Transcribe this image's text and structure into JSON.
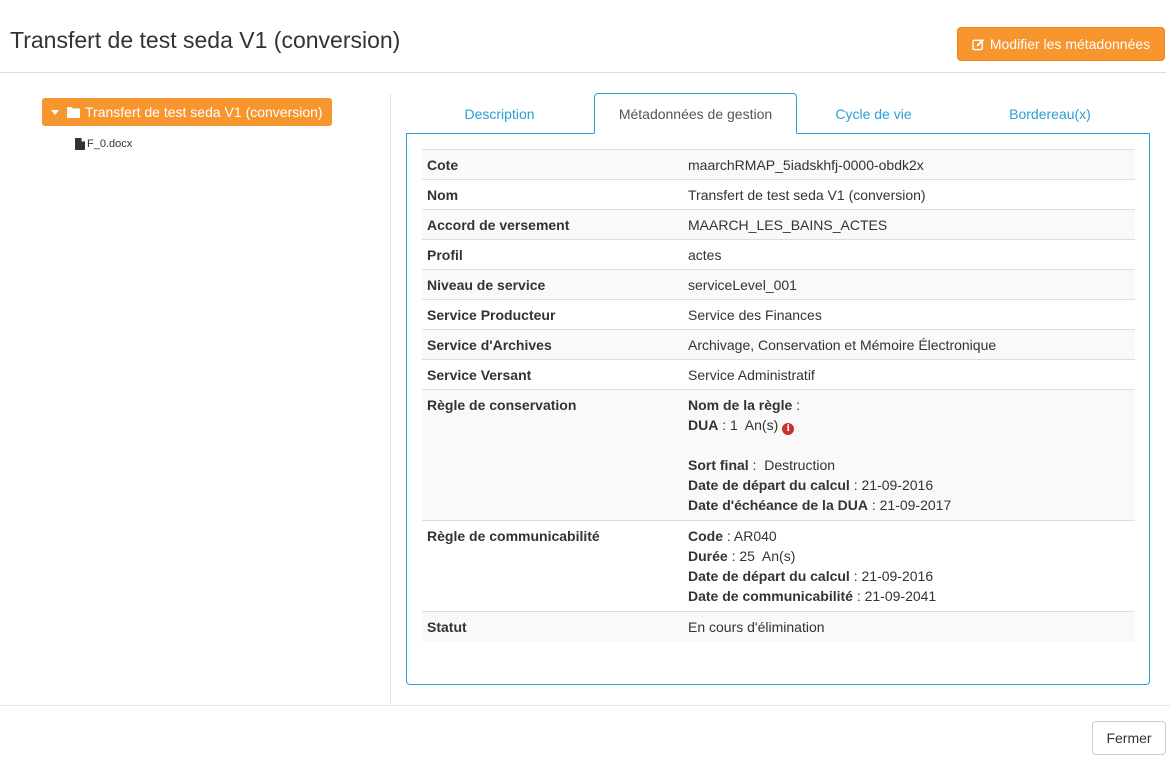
{
  "header": {
    "title": "Transfert de test seda V1 (conversion)",
    "edit_button": "Modifier les métadonnées"
  },
  "tree": {
    "root_label": "Transfert de test seda V1 (conversion)",
    "child_label": "F_0.docx"
  },
  "tabs": [
    {
      "label": "Description"
    },
    {
      "label": "Métadonnées de gestion"
    },
    {
      "label": "Cycle de vie"
    },
    {
      "label": "Bordereau(x)"
    }
  ],
  "metadata": {
    "cote": {
      "label": "Cote",
      "value": "maarchRMAP_5iadskhfj-0000-obdk2x"
    },
    "nom": {
      "label": "Nom",
      "value": "Transfert de test seda V1 (conversion)"
    },
    "accord": {
      "label": "Accord de versement",
      "value": "MAARCH_LES_BAINS_ACTES"
    },
    "profil": {
      "label": "Profil",
      "value": "actes"
    },
    "niveau": {
      "label": "Niveau de service",
      "value": "serviceLevel_001"
    },
    "producteur": {
      "label": "Service Producteur",
      "value": "Service des Finances"
    },
    "archives": {
      "label": "Service d'Archives",
      "value": "Archivage, Conservation et Mémoire Électronique"
    },
    "versant": {
      "label": "Service Versant",
      "value": "Service Administratif"
    },
    "conservation": {
      "label": "Règle de conservation",
      "nom_regle_label": "Nom de la règle",
      "nom_regle_sep": " :",
      "dua_label": "DUA",
      "dua_value": " : 1  An(s) ",
      "sort_final_label": "Sort final",
      "sort_final_value": " :  Destruction",
      "depart_label": "Date de départ du calcul",
      "depart_value": " : 21-09-2016",
      "echeance_label": "Date d'échéance de la DUA",
      "echeance_value": " : 21-09-2017"
    },
    "communicabilite": {
      "label": "Règle de communicabilité",
      "code_label": "Code",
      "code_value": " : AR040",
      "duree_label": "Durée",
      "duree_value": " : 25  An(s)",
      "depart_label": "Date de départ du calcul",
      "depart_value": " : 21-09-2016",
      "date_label": "Date de communicabilité",
      "date_value": " : 21-09-2041"
    },
    "statut": {
      "label": "Statut",
      "value": "En cours d'élimination"
    }
  },
  "footer": {
    "close_button": "Fermer"
  },
  "icons": {
    "edit": "edit-icon",
    "folder": "folder-icon",
    "file": "file-icon",
    "info": "info-circle-icon"
  },
  "colors": {
    "accent_orange": "#f7952f",
    "link_blue": "#2a9fd6",
    "info_red": "#c9302c"
  }
}
